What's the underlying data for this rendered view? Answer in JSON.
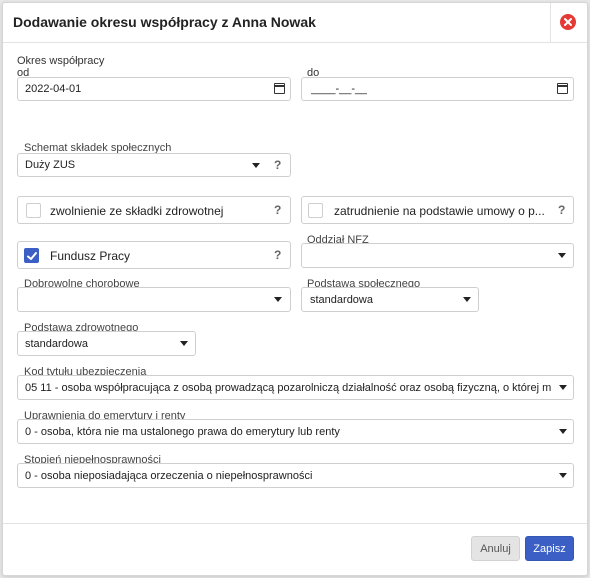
{
  "dialog": {
    "title": "Dodawanie okresu współpracy z Anna Nowak",
    "close_icon": "close-circle-icon"
  },
  "period": {
    "section_label": "Okres współpracy",
    "from_label": "od",
    "from_value": "2022-04-01",
    "to_label": "do",
    "to_value": "____-__-__"
  },
  "scheme": {
    "label": "Schemat składek społecznych",
    "value": "Duży ZUS",
    "help": "?"
  },
  "checks": {
    "health_exempt": {
      "label": "zwolnienie ze składki zdrowotnej",
      "checked": false,
      "help": "?"
    },
    "employment": {
      "label": "zatrudnienie na podstawie umowy o p...",
      "checked": false,
      "help": "?"
    },
    "labor_fund": {
      "label": "Fundusz Pracy",
      "checked": true,
      "help": "?"
    }
  },
  "nfz": {
    "label": "Oddział NFZ",
    "value": ""
  },
  "sickness": {
    "label": "Dobrowolne chorobowe",
    "value": ""
  },
  "social_base": {
    "label": "Podstawa społecznego",
    "value": "standardowa"
  },
  "health_base": {
    "label": "Podstawa zdrowotnego",
    "value": "standardowa"
  },
  "insurance_code": {
    "label": "Kod tytułu ubezpieczenia",
    "value": "05 11 - osoba współpracująca z osobą prowadzącą pozarolniczą działalność oraz osobą fizyczną, o której m"
  },
  "pension": {
    "label": "Uprawnienia do emerytury i renty",
    "value": "0 - osoba, która nie ma ustalonego prawa do emerytury lub renty"
  },
  "disability": {
    "label": "Stopień niepełnosprawności",
    "value": "0 - osoba nieposiadająca orzeczenia o niepełnosprawności"
  },
  "footer": {
    "cancel_label": "Anuluj",
    "save_label": "Zapisz"
  },
  "colors": {
    "accent": "#3b5fc4",
    "close": "#e53935"
  }
}
